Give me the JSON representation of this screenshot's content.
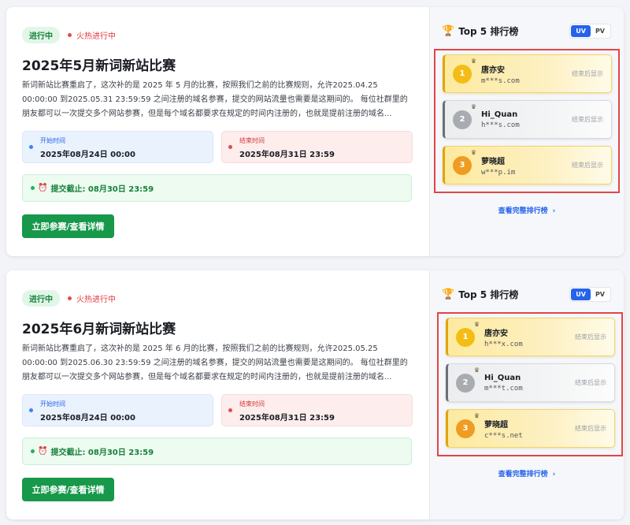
{
  "competitions": [
    {
      "status_label": "进行中",
      "hot_label": "火热进行中",
      "title": "2025年5月新词新站比赛",
      "description": "新词新站比赛重启了，这次补的是 2025 年 5 月的比赛，按照我们之前的比赛规则，允许2025.04.25 00:00:00 到2025.05.31 23:59:59 之间注册的域名参赛，提交的网站流量也需要是这期间的。 每位社群里的朋友都可以一次提交多个网站参赛，但是每个域名都要求在规定的时间内注册的，也就是提前注册的域名...",
      "start_label": "开始时间",
      "start_value": "2025年08月24日 00:00",
      "end_label": "结束时间",
      "end_value": "2025年08月31日 23:59",
      "deadline_icon": "⏰",
      "deadline_text": "提交截止: 08月30日 23:59",
      "join_button": "立即参赛/查看详情",
      "leaderboard": {
        "trophy_icon": "🏆",
        "title": "Top 5 排行榜",
        "toggle_uv": "UV",
        "toggle_pv": "PV",
        "active_toggle": "UV",
        "entries": [
          {
            "rank": "1",
            "name": "唐亦安",
            "domain": "m***s.com",
            "score": "结束后显示"
          },
          {
            "rank": "2",
            "name": "Hi_Quan",
            "domain": "h***s.com",
            "score": "结束后显示"
          },
          {
            "rank": "3",
            "name": "萝晓超",
            "domain": "w***p.im",
            "score": "结束后显示"
          }
        ],
        "view_full": "查看完整排行榜",
        "chevron": "›"
      }
    },
    {
      "status_label": "进行中",
      "hot_label": "火热进行中",
      "title": "2025年6月新词新站比赛",
      "description": "新词新站比赛重启了，这次补的是 2025 年 6 月的比赛，按照我们之前的比赛规则，允许2025.05.25 00:00:00 到2025.06.30 23:59:59 之间注册的域名参赛，提交的网站流量也需要是这期间的。 每位社群里的朋友都可以一次提交多个网站参赛，但是每个域名都要求在规定的时间内注册的，也就是提前注册的域名...",
      "start_label": "开始时间",
      "start_value": "2025年08月24日 00:00",
      "end_label": "结束时间",
      "end_value": "2025年08月31日 23:59",
      "deadline_icon": "⏰",
      "deadline_text": "提交截止: 08月30日 23:59",
      "join_button": "立即参赛/查看详情",
      "leaderboard": {
        "trophy_icon": "🏆",
        "title": "Top 5 排行榜",
        "toggle_uv": "UV",
        "toggle_pv": "PV",
        "active_toggle": "UV",
        "entries": [
          {
            "rank": "1",
            "name": "唐亦安",
            "domain": "h***x.com",
            "score": "结束后显示"
          },
          {
            "rank": "2",
            "name": "Hi_Quan",
            "domain": "m***t.com",
            "score": "结束后显示"
          },
          {
            "rank": "3",
            "name": "萝晓超",
            "domain": "c***s.net",
            "score": "结束后显示"
          }
        ],
        "view_full": "查看完整排行榜",
        "chevron": "›"
      }
    }
  ],
  "colors": {
    "accent_green": "#17984a",
    "accent_blue": "#2563eb",
    "highlight_red": "#e24545",
    "gold": "#f4bd16",
    "silver": "#a8abb0",
    "bronze": "#ee9d22"
  }
}
